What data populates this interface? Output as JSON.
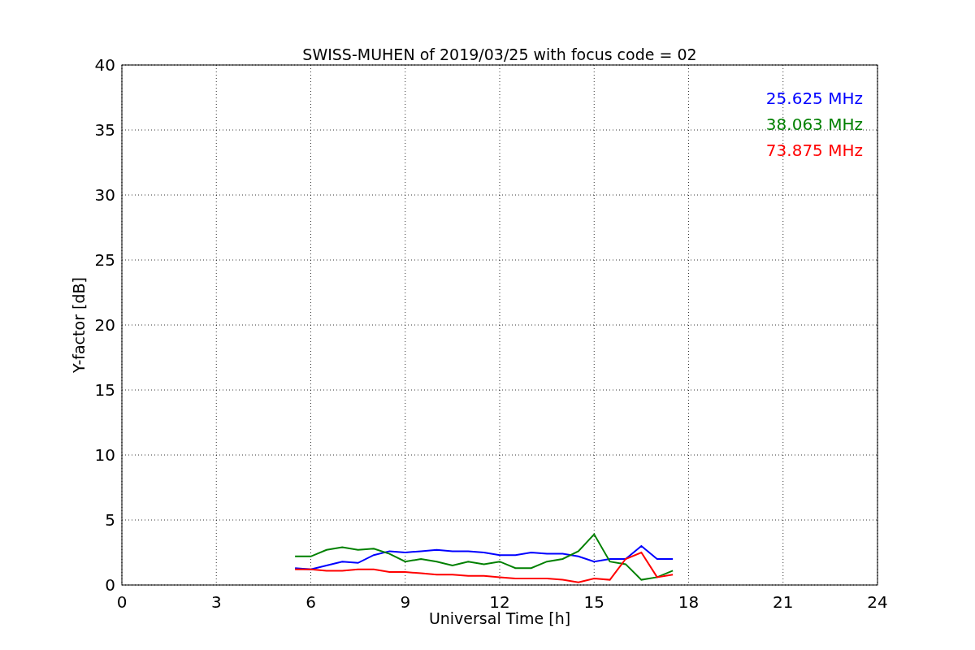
{
  "chart_data": {
    "type": "line",
    "title": "SWISS-MUHEN of 2019/03/25 with focus code = 02",
    "xlabel": "Universal Time [h]",
    "ylabel": "Y-factor [dB]",
    "x": [
      5.5,
      6,
      6.5,
      7,
      7.5,
      8,
      8.5,
      9,
      9.5,
      10,
      10.5,
      11,
      11.5,
      12,
      12.5,
      13,
      13.5,
      14,
      14.5,
      15,
      15.5,
      16,
      16.5,
      17,
      17.5
    ],
    "series": [
      {
        "name": "25.625 MHz",
        "color": "#0000ff",
        "values": [
          1.3,
          1.2,
          1.5,
          1.8,
          1.7,
          2.3,
          2.6,
          2.5,
          2.6,
          2.7,
          2.6,
          2.6,
          2.5,
          2.3,
          2.3,
          2.5,
          2.4,
          2.4,
          2.2,
          1.8,
          2.0,
          2.0,
          3.0,
          2.0,
          2.0
        ]
      },
      {
        "name": "38.063 MHz",
        "color": "#008000",
        "values": [
          2.2,
          2.2,
          2.7,
          2.9,
          2.7,
          2.8,
          2.4,
          1.8,
          2.0,
          1.8,
          1.5,
          1.8,
          1.6,
          1.8,
          1.3,
          1.3,
          1.8,
          2.0,
          2.6,
          3.9,
          1.8,
          1.6,
          0.4,
          0.6,
          1.1
        ]
      },
      {
        "name": "73.875 MHz",
        "color": "#ff0000",
        "values": [
          1.2,
          1.2,
          1.1,
          1.1,
          1.2,
          1.2,
          1.0,
          1.0,
          0.9,
          0.8,
          0.8,
          0.7,
          0.7,
          0.6,
          0.5,
          0.5,
          0.5,
          0.4,
          0.2,
          0.5,
          0.4,
          2.0,
          2.5,
          0.6,
          0.8
        ]
      }
    ],
    "xlim": [
      0,
      24
    ],
    "ylim": [
      0,
      40
    ],
    "xticks": [
      0,
      3,
      6,
      9,
      12,
      15,
      18,
      21,
      24
    ],
    "yticks": [
      0,
      5,
      10,
      15,
      20,
      25,
      30,
      35,
      40
    ],
    "grid": true
  }
}
